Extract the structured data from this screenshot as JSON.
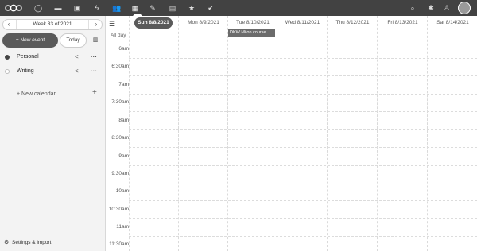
{
  "topbar": {
    "apps": [
      "dashboard-icon",
      "files-icon",
      "photos-icon",
      "activity-icon",
      "contacts-icon",
      "calendar-icon",
      "notes-icon",
      "deck-icon",
      "bookmarks-icon",
      "tasks-icon"
    ],
    "right": [
      "search-icon",
      "notifications-icon",
      "contacts-menu-icon",
      "avatar"
    ]
  },
  "sidebar": {
    "week_label": "Week 33 of 2021",
    "new_event": "+ New event",
    "today": "Today",
    "calendars": [
      {
        "name": "Personal",
        "color": "#444444"
      },
      {
        "name": "Writing",
        "color": "#bdbdbd"
      }
    ],
    "new_calendar": "+ New calendar",
    "settings": "Settings & import"
  },
  "calendar": {
    "allday_label": "All day",
    "days": [
      "Sun 8/8/2021",
      "Mon 8/9/2021",
      "Tue 8/10/2021",
      "Wed 8/11/2021",
      "Thu 8/12/2021",
      "Fri 8/13/2021",
      "Sat 8/14/2021"
    ],
    "event": {
      "title": "DKW Milon course",
      "day_index": 2
    },
    "times": [
      "6am",
      "6:30am",
      "7am",
      "7:30am",
      "8am",
      "8:30am",
      "9am",
      "9:30am",
      "10am",
      "10:30am",
      "11am",
      "11:30am"
    ]
  }
}
